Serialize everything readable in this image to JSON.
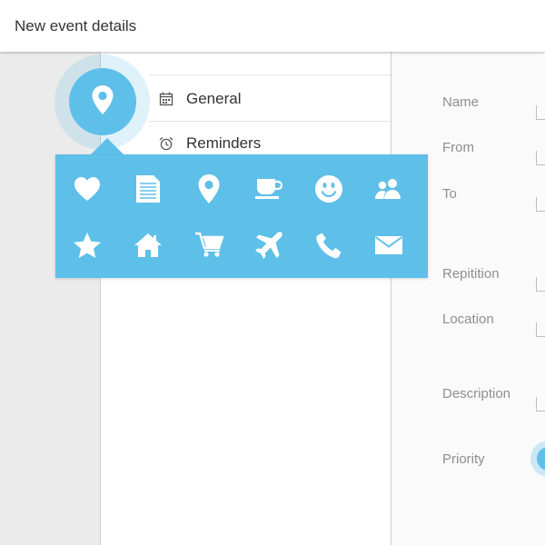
{
  "header": {
    "title": "New event details"
  },
  "menu": {
    "items": [
      {
        "label": "General",
        "icon": "calendar-icon"
      },
      {
        "label": "Reminders",
        "icon": "alarm-clock-icon"
      }
    ]
  },
  "fab": {
    "icon": "map-pin-icon"
  },
  "icon_picker": {
    "rows": [
      [
        "heart-icon",
        "document-icon",
        "map-pin-icon",
        "coffee-cup-icon",
        "smiley-icon",
        "people-icon"
      ],
      [
        "star-icon",
        "home-icon",
        "shopping-cart-icon",
        "airplane-icon",
        "phone-icon",
        "envelope-icon"
      ]
    ]
  },
  "form": {
    "labels": {
      "name": "Name",
      "from": "From",
      "to": "To",
      "repetition": "Repitition",
      "location": "Location",
      "description": "Description",
      "priority": "Priority"
    }
  },
  "colors": {
    "accent": "#5ebfe9",
    "background_gutter": "#ebebeb",
    "label_gray": "#8e8e8e"
  }
}
